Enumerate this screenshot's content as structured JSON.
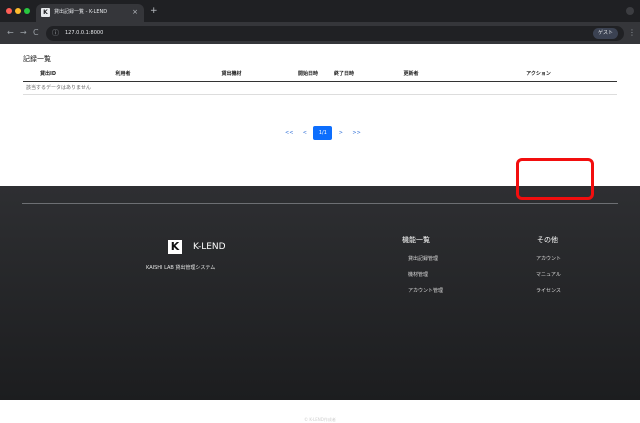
{
  "browser": {
    "tab_favicon": "K",
    "tab_title": "貸出記録一覧 - K-LEND",
    "tab_close": "×",
    "new_tab": "+",
    "nav_back": "←",
    "nav_forward": "→",
    "nav_reload": "C",
    "url": "127.0.0.1:8000",
    "profile_label": "ゲスト",
    "menu": "⋮"
  },
  "main": {
    "section_title": "記録一覧",
    "columns": [
      "貸出ID",
      "利用者",
      "貸出機材",
      "開始日時",
      "終了日時",
      "更新者",
      "アクション"
    ],
    "empty_message": "該当するデータはありません",
    "pagination": [
      "<<",
      "<",
      "1/1",
      ">",
      ">>"
    ],
    "pagination_active": "1/1"
  },
  "footer": {
    "logo_letter": "K",
    "brand_name": "K-LEND",
    "brand_sub": "KAISHI LAB 貸出管理システム",
    "functions": {
      "title": "機能一覧",
      "links": [
        "貸出記録管理",
        "機材管理",
        "アカウント管理"
      ]
    },
    "other": {
      "title": "その他",
      "links": [
        "アカウント",
        "マニュアル",
        "ライセンス"
      ]
    },
    "copyright": "© K-LEND作成者"
  },
  "colors": {
    "pagination_active": "#0d6efd",
    "highlight_box": "#f20e0e",
    "footer_bg": "#2e2f32"
  }
}
